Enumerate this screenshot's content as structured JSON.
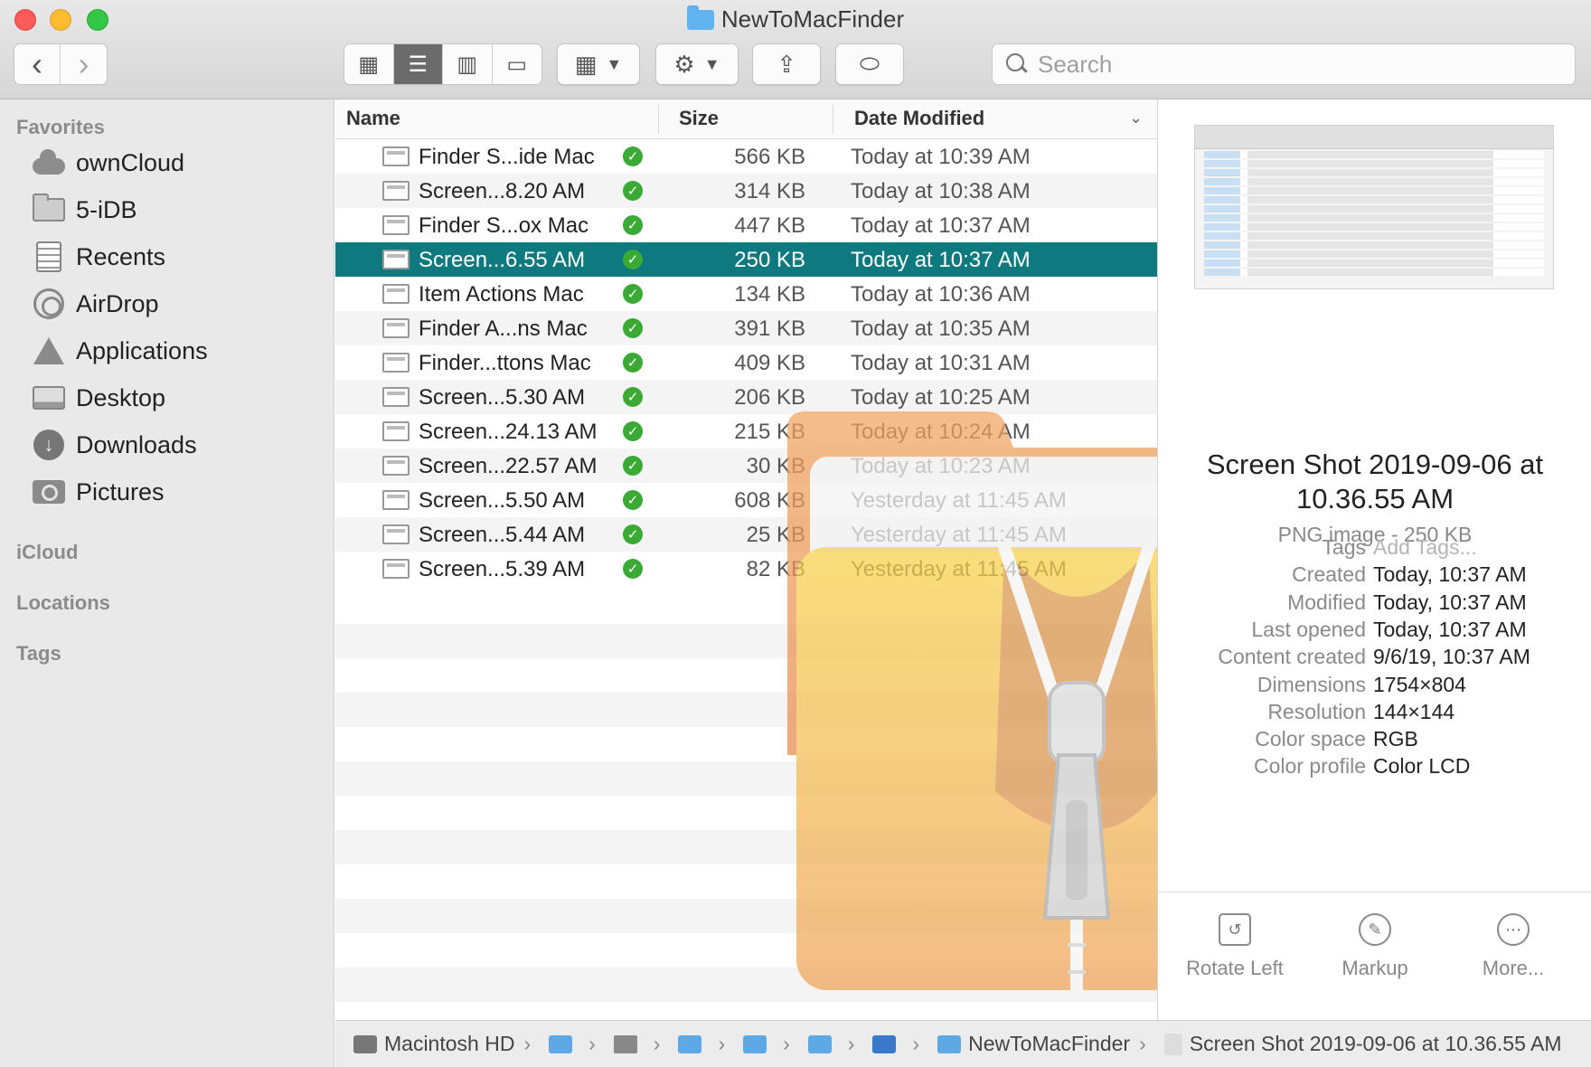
{
  "window": {
    "title": "NewToMacFinder"
  },
  "toolbar": {
    "back": "‹",
    "forward": "›",
    "views": [
      "icon-view",
      "list-view",
      "column-view",
      "gallery-view"
    ],
    "search_placeholder": "Search"
  },
  "sidebar": {
    "favorites_label": "Favorites",
    "items": [
      {
        "label": "ownCloud",
        "icon": "cloud-icon"
      },
      {
        "label": "5-iDB",
        "icon": "folder-icon"
      },
      {
        "label": "Recents",
        "icon": "recents-icon"
      },
      {
        "label": "AirDrop",
        "icon": "airdrop-icon"
      },
      {
        "label": "Applications",
        "icon": "applications-icon"
      },
      {
        "label": "Desktop",
        "icon": "desktop-icon"
      },
      {
        "label": "Downloads",
        "icon": "downloads-icon"
      },
      {
        "label": "Pictures",
        "icon": "pictures-icon"
      }
    ],
    "icloud_label": "iCloud",
    "locations_label": "Locations",
    "tags_label": "Tags"
  },
  "list": {
    "columns": {
      "name": "Name",
      "size": "Size",
      "date": "Date Modified"
    },
    "rows": [
      {
        "name": "Finder S...ide Mac",
        "size": "566 KB",
        "date": "Today at 10:39 AM"
      },
      {
        "name": "Screen...8.20 AM",
        "size": "314 KB",
        "date": "Today at 10:38 AM"
      },
      {
        "name": "Finder S...ox Mac",
        "size": "447 KB",
        "date": "Today at 10:37 AM"
      },
      {
        "name": "Screen...6.55 AM",
        "size": "250 KB",
        "date": "Today at 10:37 AM",
        "selected": true
      },
      {
        "name": "Item Actions Mac",
        "size": "134 KB",
        "date": "Today at 10:36 AM"
      },
      {
        "name": "Finder A...ns Mac",
        "size": "391 KB",
        "date": "Today at 10:35 AM"
      },
      {
        "name": "Finder...ttons Mac",
        "size": "409 KB",
        "date": "Today at 10:31 AM"
      },
      {
        "name": "Screen...5.30 AM",
        "size": "206 KB",
        "date": "Today at 10:25 AM"
      },
      {
        "name": "Screen...24.13 AM",
        "size": "215 KB",
        "date": "Today at 10:24 AM"
      },
      {
        "name": "Screen...22.57 AM",
        "size": "30 KB",
        "date": "Today at 10:23 AM"
      },
      {
        "name": "Screen...5.50 AM",
        "size": "608 KB",
        "date": "Yesterday at 11:45 AM"
      },
      {
        "name": "Screen...5.44 AM",
        "size": "25 KB",
        "date": "Yesterday at 11:45 AM"
      },
      {
        "name": "Screen...5.39 AM",
        "size": "82 KB",
        "date": "Yesterday at 11:45 AM"
      }
    ]
  },
  "preview": {
    "title": "Screen Shot 2019-09-06 at 10.36.55 AM",
    "subtitle": "PNG image - 250 KB",
    "meta": [
      {
        "key": "Tags",
        "value": "Add Tags...",
        "placeholder": true
      },
      {
        "key": "Created",
        "value": "Today, 10:37 AM"
      },
      {
        "key": "Modified",
        "value": "Today, 10:37 AM"
      },
      {
        "key": "Last opened",
        "value": "Today, 10:37 AM"
      },
      {
        "key": "Content created",
        "value": "9/6/19, 10:37 AM"
      },
      {
        "key": "Dimensions",
        "value": "1754×804"
      },
      {
        "key": "Resolution",
        "value": "144×144"
      },
      {
        "key": "Color space",
        "value": "RGB"
      },
      {
        "key": "Color profile",
        "value": "Color LCD"
      }
    ],
    "actions": [
      {
        "label": "Rotate Left",
        "icon": "rotate-left-icon"
      },
      {
        "label": "Markup",
        "icon": "markup-icon"
      },
      {
        "label": "More...",
        "icon": "more-icon"
      }
    ]
  },
  "pathbar": {
    "start": "Macintosh HD",
    "folder": "NewToMacFinder",
    "file": "Screen Shot 2019-09-06 at 10.36.55 AM"
  },
  "colors": {
    "selection": "#0e7a80",
    "check": "#3aaa35",
    "accent": "#5fb4f0"
  }
}
